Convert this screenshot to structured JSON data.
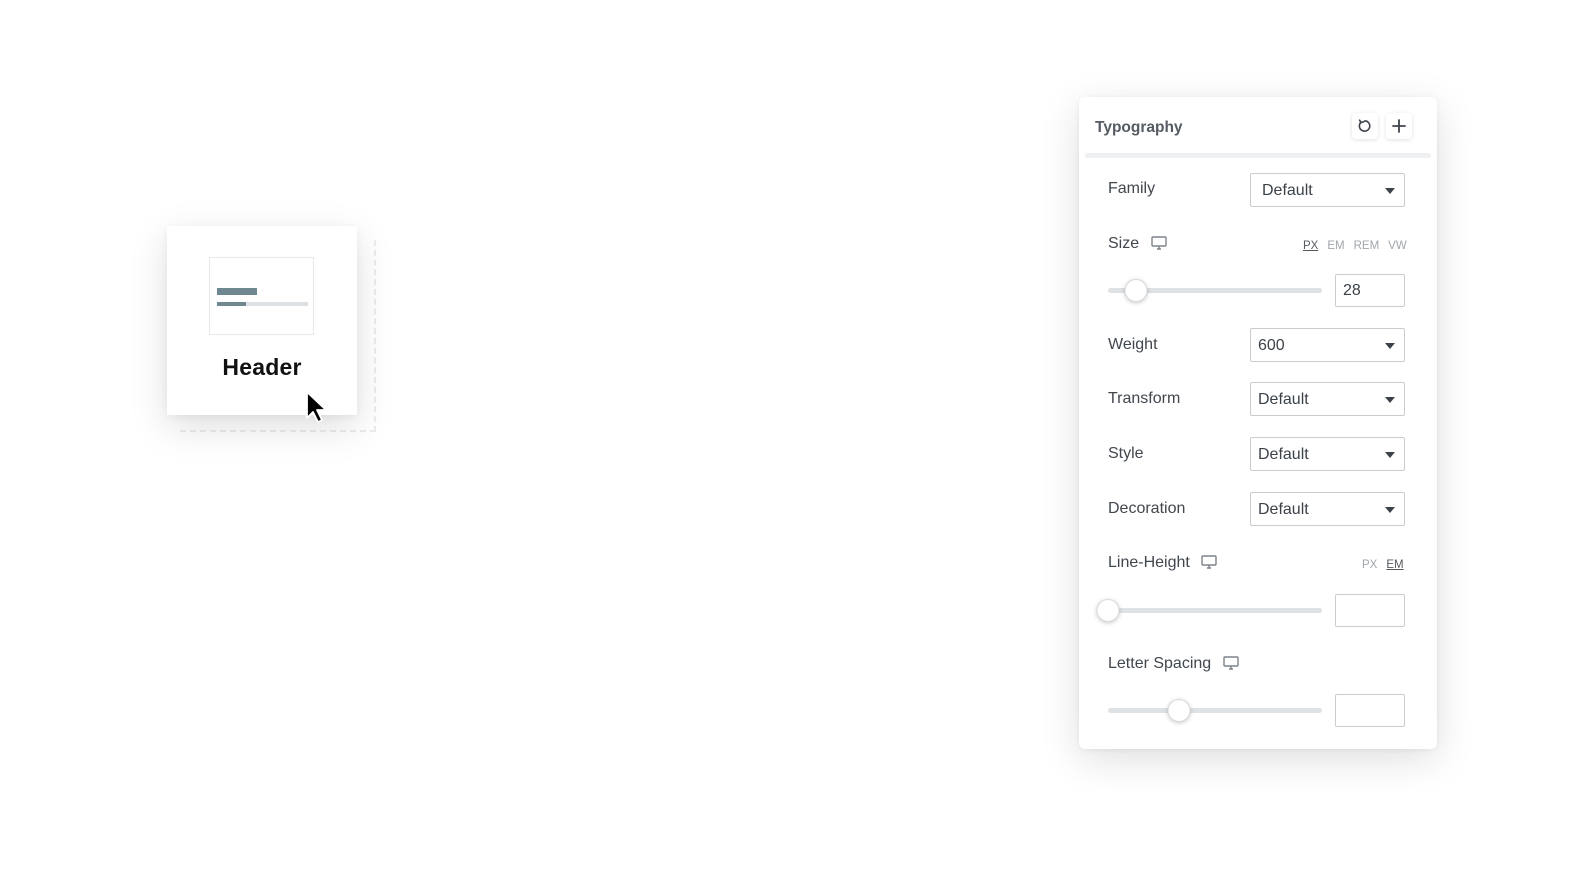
{
  "widget": {
    "label": "Header",
    "icon": "header-widget-icon"
  },
  "panel": {
    "title": "Typography",
    "reset_icon": "reset-icon",
    "add_icon": "plus-icon",
    "family": {
      "label": "Family",
      "value": "Default"
    },
    "size": {
      "label": "Size",
      "units": [
        "PX",
        "EM",
        "REM",
        "VW"
      ],
      "active_unit": "PX",
      "value": "28",
      "slider_fraction": 0.13
    },
    "weight": {
      "label": "Weight",
      "value": "600"
    },
    "transform": {
      "label": "Transform",
      "value": "Default"
    },
    "style": {
      "label": "Style",
      "value": "Default"
    },
    "decoration": {
      "label": "Decoration",
      "value": "Default"
    },
    "line_height": {
      "label": "Line-Height",
      "units": [
        "PX",
        "EM"
      ],
      "active_unit": "EM",
      "value": "",
      "slider_fraction": 0.0
    },
    "letter_spacing": {
      "label": "Letter Spacing",
      "value": "",
      "slider_fraction": 0.33
    },
    "responsive_icon": "desktop-monitor-icon"
  },
  "colors": {
    "preview_accent": "#6f8791",
    "panel_border": "#c9cdd1"
  }
}
